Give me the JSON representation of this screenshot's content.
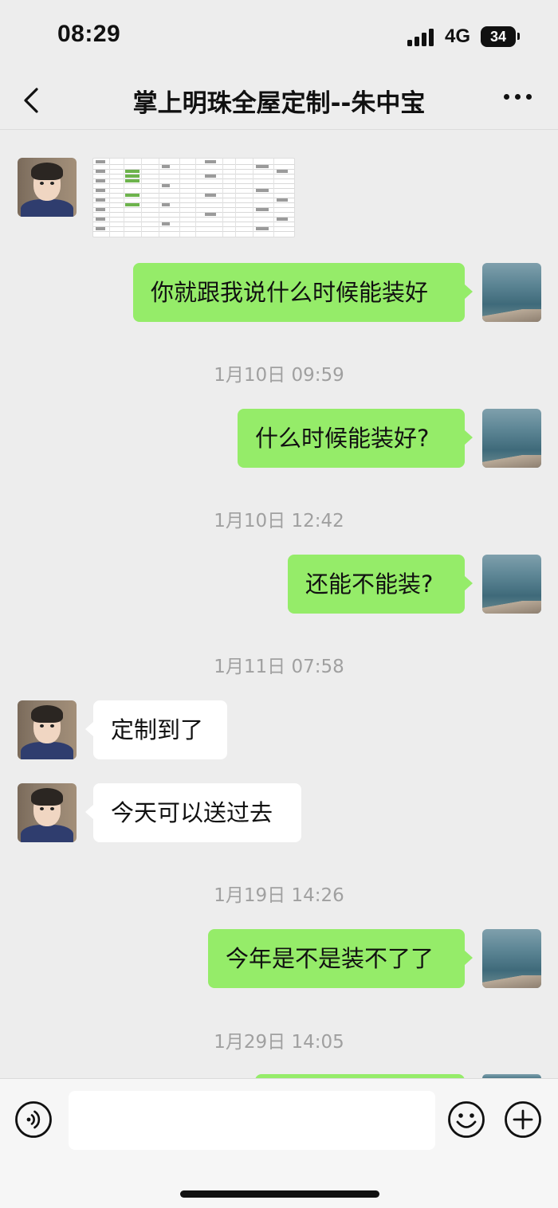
{
  "status_bar": {
    "time": "08:29",
    "network": "4G",
    "battery": "34"
  },
  "nav": {
    "title": "掌上明珠全屋定制--朱中宝",
    "back_icon": "chevron-left-icon",
    "more_icon": "more-dots-icon"
  },
  "messages": [
    {
      "from": "them",
      "type": "image",
      "content": "spreadsheet-screenshot"
    },
    {
      "from": "me",
      "text": "你就跟我说什么时候能装好"
    },
    {
      "timestamp": "1月10日 09:59"
    },
    {
      "from": "me",
      "text": "什么时候能装好?"
    },
    {
      "timestamp": "1月10日 12:42"
    },
    {
      "from": "me",
      "text": "还能不能装?"
    },
    {
      "timestamp": "1月11日 07:58"
    },
    {
      "from": "them",
      "text": "定制到了"
    },
    {
      "from": "them",
      "text": "今天可以送过去"
    },
    {
      "timestamp": "1月19日 14:26"
    },
    {
      "from": "me",
      "text": "今年是不是装不了了"
    },
    {
      "timestamp": "1月29日 14:05"
    }
  ],
  "input_bar": {
    "voice_icon": "voice-icon",
    "emoji_icon": "emoji-icon",
    "plus_icon": "plus-icon",
    "input_value": ""
  },
  "colors": {
    "my_bubble": "#95ec69",
    "their_bubble": "#ffffff",
    "background": "#ededed"
  }
}
